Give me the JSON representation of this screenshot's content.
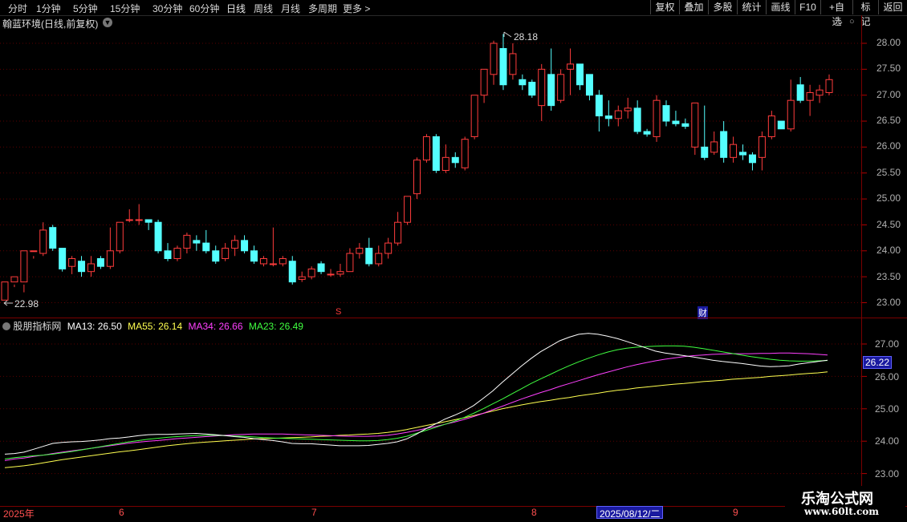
{
  "toolbar": {
    "timeframes": [
      "分时",
      "1分钟",
      "5分钟",
      "15分钟",
      "30分钟",
      "60分钟",
      "日线",
      "周线",
      "月线",
      "多周期",
      "更多 >"
    ],
    "active": "日线",
    "buttons": [
      "复权",
      "叠加",
      "多股",
      "统计",
      "画线",
      "F10",
      "+自选",
      "标记",
      "返回"
    ]
  },
  "stock": {
    "name": "翰蓝环境(日线,前复权)"
  },
  "price_axis": [
    "28.00",
    "27.50",
    "27.00",
    "26.50",
    "26.00",
    "25.50",
    "25.00",
    "24.50",
    "24.00",
    "23.50",
    "23.00"
  ],
  "annotations": {
    "high": "28.18",
    "low": "22.98",
    "marker_s": "S",
    "marker_cai": "财"
  },
  "indicator": {
    "name": "股朋指标网",
    "ma13": "MA13: 26.50",
    "ma55": "MA55: 26.14",
    "ma34": "MA34: 26.66",
    "ma23": "MA23: 26.49",
    "axis": [
      "27.00",
      "26.00",
      "25.00",
      "24.00",
      "23.00"
    ],
    "current_value": "26.22"
  },
  "time_axis": {
    "labels": [
      "2025年",
      "6",
      "7",
      "8",
      "9"
    ],
    "cursor_date": "2025/08/12/二"
  },
  "watermark": {
    "line1": "乐淘公式网",
    "line2": "www.60lt.com"
  },
  "colors": {
    "up": "#ff3c3c",
    "down": "#54ffff",
    "ma13": "#ffffff",
    "ma55": "#ffff50",
    "ma34": "#ff40ff",
    "ma23": "#40ff40"
  },
  "chart_data": {
    "type": "candlestick",
    "candles": [
      [
        23.05,
        23.4,
        23.0,
        22.98
      ],
      [
        23.4,
        23.5,
        23.35,
        23.3
      ],
      [
        23.4,
        24.0,
        23.35,
        23.2
      ],
      [
        24.0,
        24.0,
        23.9,
        23.85
      ],
      [
        23.95,
        24.4,
        24.55,
        23.9
      ],
      [
        24.45,
        24.05,
        24.5,
        24.0
      ],
      [
        24.05,
        23.65,
        24.05,
        23.6
      ],
      [
        23.7,
        23.85,
        23.9,
        23.55
      ],
      [
        23.8,
        23.6,
        23.9,
        23.5
      ],
      [
        23.6,
        23.75,
        23.9,
        23.5
      ],
      [
        23.85,
        23.7,
        23.9,
        23.65
      ],
      [
        23.7,
        24.0,
        24.45,
        23.65
      ],
      [
        24.0,
        24.55,
        24.55,
        23.95
      ],
      [
        24.6,
        24.6,
        24.8,
        24.55
      ],
      [
        24.6,
        24.6,
        24.9,
        24.5
      ],
      [
        24.6,
        24.55,
        24.6,
        24.4
      ],
      [
        24.55,
        24.0,
        24.6,
        23.95
      ],
      [
        24.0,
        23.85,
        24.15,
        23.8
      ],
      [
        23.85,
        24.05,
        24.1,
        23.8
      ],
      [
        24.05,
        24.3,
        24.35,
        23.95
      ],
      [
        24.2,
        24.15,
        24.3,
        24.0
      ],
      [
        24.15,
        24.0,
        24.4,
        23.95
      ],
      [
        24.0,
        23.8,
        24.1,
        23.75
      ],
      [
        23.85,
        24.05,
        24.15,
        23.8
      ],
      [
        24.05,
        24.2,
        24.3,
        23.9
      ],
      [
        24.2,
        24.0,
        24.3,
        23.95
      ],
      [
        24.0,
        23.8,
        24.1,
        23.75
      ],
      [
        23.75,
        23.85,
        23.9,
        23.7
      ],
      [
        23.75,
        23.75,
        24.45,
        23.7
      ],
      [
        23.75,
        23.85,
        23.9,
        23.7
      ],
      [
        23.8,
        23.4,
        23.9,
        23.35
      ],
      [
        23.45,
        23.5,
        23.6,
        23.4
      ],
      [
        23.5,
        23.65,
        23.7,
        23.45
      ],
      [
        23.75,
        23.6,
        23.8,
        23.55
      ],
      [
        23.55,
        23.55,
        23.65,
        23.5
      ],
      [
        23.55,
        23.6,
        23.75,
        23.5
      ],
      [
        23.6,
        23.95,
        24.05,
        23.6
      ],
      [
        23.95,
        24.05,
        24.15,
        23.85
      ],
      [
        24.05,
        23.75,
        24.25,
        23.7
      ],
      [
        23.75,
        23.95,
        24.1,
        23.7
      ],
      [
        23.95,
        24.15,
        24.25,
        23.85
      ],
      [
        24.15,
        24.55,
        24.75,
        24.1
      ],
      [
        24.55,
        25.05,
        25.05,
        24.5
      ],
      [
        25.1,
        25.75,
        25.8,
        25.0
      ],
      [
        25.75,
        26.2,
        26.25,
        25.7
      ],
      [
        26.2,
        25.55,
        26.25,
        25.5
      ],
      [
        25.55,
        25.8,
        26.05,
        25.5
      ],
      [
        25.8,
        25.7,
        25.9,
        25.6
      ],
      [
        25.6,
        26.15,
        26.2,
        25.55
      ],
      [
        26.2,
        27.0,
        27.0,
        26.15
      ],
      [
        27.0,
        27.5,
        27.5,
        26.85
      ],
      [
        27.4,
        28.0,
        28.05,
        27.2
      ],
      [
        27.9,
        27.2,
        28.18,
        27.1
      ],
      [
        27.4,
        27.8,
        28.0,
        27.3
      ],
      [
        27.3,
        27.2,
        27.4,
        27.1
      ],
      [
        27.25,
        27.0,
        27.3,
        26.95
      ],
      [
        26.8,
        27.5,
        27.6,
        26.5
      ],
      [
        27.4,
        26.8,
        27.9,
        26.7
      ],
      [
        26.9,
        27.4,
        27.5,
        26.85
      ],
      [
        27.5,
        27.6,
        27.9,
        27.0
      ],
      [
        27.6,
        27.2,
        27.6,
        27.1
      ],
      [
        27.4,
        27.0,
        27.4,
        26.9
      ],
      [
        27.0,
        26.6,
        27.1,
        26.3
      ],
      [
        26.6,
        26.55,
        26.9,
        26.4
      ],
      [
        26.55,
        26.7,
        26.8,
        26.4
      ],
      [
        26.7,
        26.75,
        26.95,
        26.55
      ],
      [
        26.75,
        26.3,
        26.9,
        26.25
      ],
      [
        26.3,
        26.25,
        26.35,
        26.2
      ],
      [
        26.2,
        26.9,
        27.0,
        26.1
      ],
      [
        26.8,
        26.5,
        26.9,
        26.4
      ],
      [
        26.5,
        26.45,
        26.7,
        26.4
      ],
      [
        26.45,
        26.4,
        26.55,
        26.35
      ],
      [
        26.0,
        26.85,
        26.85,
        25.85
      ],
      [
        26.0,
        25.8,
        26.8,
        25.75
      ],
      [
        25.9,
        26.1,
        26.3,
        25.85
      ],
      [
        26.3,
        25.8,
        26.5,
        25.7
      ],
      [
        25.8,
        26.05,
        26.2,
        25.7
      ],
      [
        25.9,
        25.85,
        26.05,
        25.75
      ],
      [
        25.85,
        25.7,
        25.9,
        25.55
      ],
      [
        25.8,
        26.2,
        26.3,
        25.55
      ],
      [
        26.2,
        26.6,
        26.7,
        26.15
      ],
      [
        26.5,
        26.35,
        26.5,
        26.35
      ],
      [
        26.35,
        26.9,
        27.3,
        26.3
      ],
      [
        27.2,
        26.9,
        27.35,
        26.85
      ],
      [
        26.9,
        27.05,
        27.2,
        26.6
      ],
      [
        27.0,
        27.1,
        27.2,
        26.85
      ],
      [
        27.05,
        27.3,
        27.4,
        27.0
      ]
    ],
    "ma_series": {
      "MA13": [
        23.6,
        23.62,
        23.66,
        23.75,
        23.84,
        23.93,
        23.96,
        23.98,
        23.99,
        24.01,
        24.04,
        24.08,
        24.1,
        24.13,
        24.17,
        24.2,
        24.21,
        24.21,
        24.22,
        24.23,
        24.24,
        24.22,
        24.2,
        24.17,
        24.14,
        24.12,
        24.08,
        24.05,
        24.02,
        23.98,
        23.93,
        23.92,
        23.92,
        23.9,
        23.88,
        23.86,
        23.86,
        23.86,
        23.87,
        23.9,
        23.93,
        23.98,
        24.07,
        24.21,
        24.38,
        24.53,
        24.68,
        24.8,
        24.93,
        25.1,
        25.32,
        25.55,
        25.82,
        26.07,
        26.32,
        26.55,
        26.76,
        26.93,
        27.1,
        27.21,
        27.3,
        27.33,
        27.3,
        27.24,
        27.17,
        27.08,
        26.98,
        26.88,
        26.78,
        26.72,
        26.68,
        26.64,
        26.6,
        26.55,
        26.5,
        26.46,
        26.43,
        26.4,
        26.36,
        26.32,
        26.3,
        26.31,
        26.33,
        26.38,
        26.42,
        26.46,
        26.5
      ],
      "MA55": [
        23.18,
        23.21,
        23.24,
        23.28,
        23.33,
        23.38,
        23.43,
        23.47,
        23.51,
        23.55,
        23.59,
        23.63,
        23.67,
        23.7,
        23.74,
        23.78,
        23.82,
        23.86,
        23.89,
        23.92,
        23.95,
        23.97,
        23.99,
        24.01,
        24.03,
        24.05,
        24.07,
        24.08,
        24.09,
        24.1,
        24.11,
        24.12,
        24.13,
        24.15,
        24.16,
        24.18,
        24.19,
        24.21,
        24.22,
        24.24,
        24.27,
        24.31,
        24.36,
        24.42,
        24.48,
        24.54,
        24.6,
        24.66,
        24.72,
        24.79,
        24.86,
        24.93,
        25.0,
        25.06,
        25.12,
        25.17,
        25.22,
        25.26,
        25.31,
        25.35,
        25.4,
        25.44,
        25.48,
        25.53,
        25.57,
        25.6,
        25.64,
        25.67,
        25.7,
        25.73,
        25.76,
        25.78,
        25.81,
        25.84,
        25.86,
        25.88,
        25.91,
        25.93,
        25.95,
        25.97,
        26.0,
        26.02,
        26.04,
        26.07,
        26.09,
        26.11,
        26.14
      ],
      "MA34": [
        23.4,
        23.45,
        23.48,
        23.53,
        23.57,
        23.62,
        23.66,
        23.7,
        23.74,
        23.78,
        23.82,
        23.86,
        23.9,
        23.94,
        23.97,
        24.0,
        24.02,
        24.05,
        24.08,
        24.1,
        24.12,
        24.14,
        24.16,
        24.18,
        24.2,
        24.21,
        24.22,
        24.22,
        24.22,
        24.22,
        24.21,
        24.2,
        24.19,
        24.18,
        24.17,
        24.16,
        24.15,
        24.15,
        24.15,
        24.16,
        24.18,
        24.22,
        24.27,
        24.33,
        24.39,
        24.45,
        24.52,
        24.59,
        24.67,
        24.76,
        24.86,
        24.97,
        25.08,
        25.19,
        25.3,
        25.4,
        25.5,
        25.59,
        25.69,
        25.78,
        25.87,
        25.96,
        26.05,
        26.13,
        26.21,
        26.29,
        26.36,
        26.42,
        26.48,
        26.53,
        26.57,
        26.61,
        26.64,
        26.66,
        26.68,
        26.69,
        26.7,
        26.7,
        26.7,
        26.71,
        26.71,
        26.72,
        26.72,
        26.71,
        26.7,
        26.68,
        26.66
      ],
      "MA23": [
        23.45,
        23.49,
        23.52,
        23.55,
        23.57,
        23.6,
        23.64,
        23.68,
        23.73,
        23.78,
        23.83,
        23.88,
        23.93,
        23.98,
        24.02,
        24.06,
        24.09,
        24.12,
        24.14,
        24.16,
        24.17,
        24.18,
        24.18,
        24.17,
        24.16,
        24.15,
        24.13,
        24.11,
        24.1,
        24.09,
        24.08,
        24.07,
        24.06,
        24.05,
        24.04,
        24.03,
        24.02,
        24.01,
        24.01,
        24.02,
        24.05,
        24.09,
        24.15,
        24.24,
        24.33,
        24.42,
        24.52,
        24.62,
        24.73,
        24.86,
        25.0,
        25.15,
        25.3,
        25.46,
        25.62,
        25.78,
        25.92,
        26.06,
        26.2,
        26.33,
        26.45,
        26.56,
        26.66,
        26.75,
        26.82,
        26.87,
        26.9,
        26.92,
        26.93,
        26.94,
        26.94,
        26.93,
        26.9,
        26.86,
        26.81,
        26.76,
        26.71,
        26.66,
        26.61,
        26.57,
        26.53,
        26.5,
        26.48,
        26.47,
        26.47,
        26.48,
        26.49
      ]
    }
  }
}
